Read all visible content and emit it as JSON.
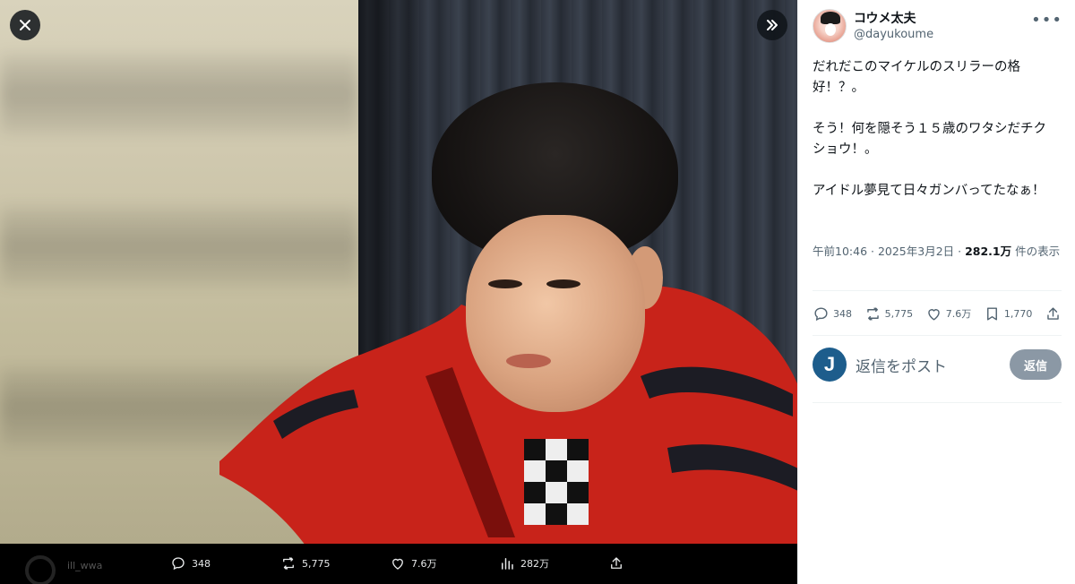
{
  "media": {
    "close_icon": "close-icon",
    "expand_icon": "double-chevron-right-icon",
    "ghost_name": "ill_wwa",
    "bar": {
      "replies": "348",
      "reposts": "5,775",
      "likes": "7.6万",
      "views": "282万"
    }
  },
  "tweet": {
    "display_name": "コウメ太夫",
    "handle": "@dayukoume",
    "paragraphs": [
      "だれだこのマイケルのスリラーの格好！？。",
      "そう！何を隠そう１５歳のワタシだチクショウ！。",
      "アイドル夢見て日々ガンバってたなぁ！"
    ],
    "time": "午前10:46",
    "sep1": " · ",
    "date": "2025年3月2日",
    "sep2": " · ",
    "views": "282.1万",
    "views_suffix": " 件の表示",
    "stats": {
      "replies": "348",
      "reposts": "5,775",
      "likes": "7.6万",
      "bookmarks": "1,770"
    }
  },
  "reply": {
    "avatar_letter": "J",
    "placeholder": "返信をポスト",
    "button": "返信"
  },
  "colors": {
    "accent_disabled": "#8b98a5",
    "text_primary": "#0f1419",
    "text_secondary": "#536471",
    "reply_avatar": "#1d5d8c"
  }
}
